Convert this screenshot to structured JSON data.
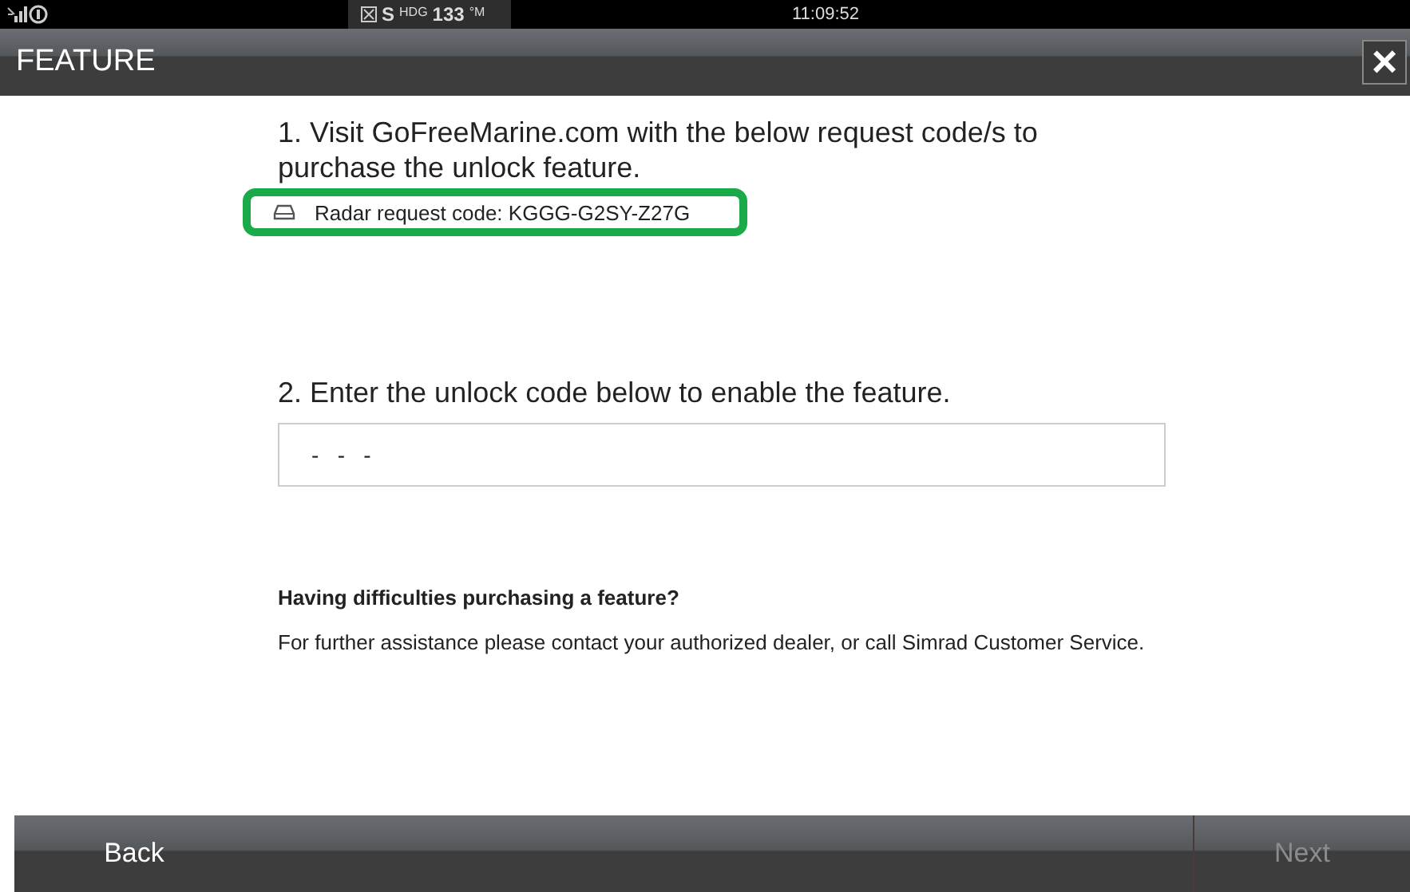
{
  "status_bar": {
    "heading_source": "S",
    "heading_label": "HDG",
    "heading_value": "133",
    "heading_unit": "°M",
    "time": "11:09:52"
  },
  "title_bar": {
    "title": "FEATURE",
    "close_label": "×"
  },
  "step_1": {
    "text": "1. Visit GoFreeMarine.com with the below request code/s to purchase the unlock feature.",
    "request_code": {
      "text": "Radar request code: KGGG-G2SY-Z27G",
      "highlighted": true
    }
  },
  "step_2": {
    "text": "2. Enter the unlock code below to enable the feature.",
    "unlock_field": {
      "value": "-   -   -"
    }
  },
  "help": {
    "heading": "Having difficulties purchasing a feature?",
    "text": "For further assistance please contact your authorized dealer, or call Simrad Customer Service."
  },
  "footer": {
    "buttons": [
      {
        "label": "Back",
        "disabled": false
      },
      {
        "label": "Next",
        "disabled": true
      }
    ]
  }
}
